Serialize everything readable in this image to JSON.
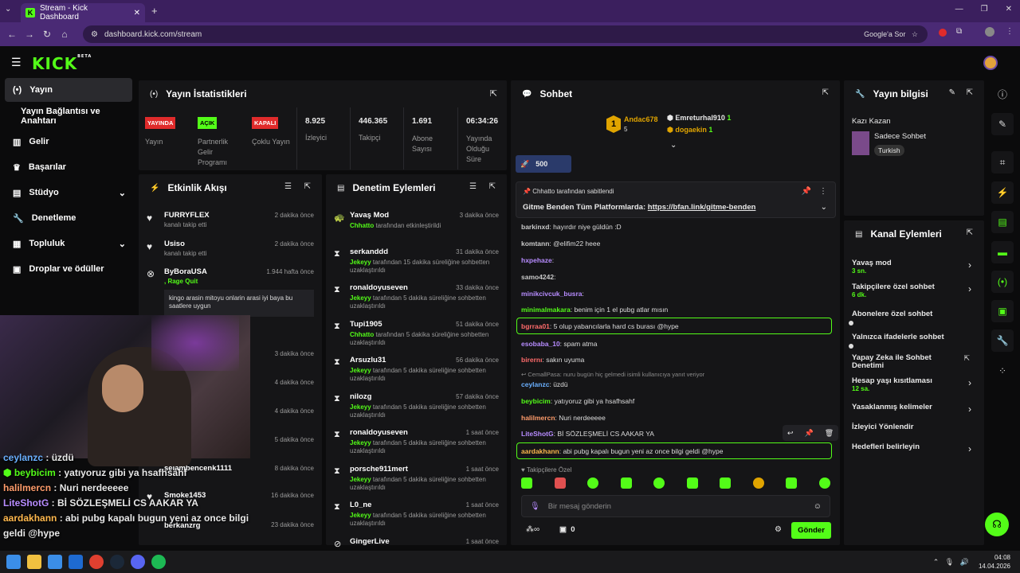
{
  "browser": {
    "tab_title": "Stream - Kick Dashboard",
    "url": "dashboard.kick.com/stream",
    "google_btn": "Google'a Sor"
  },
  "brand": {
    "logo": "KICK",
    "beta": "BETA",
    "accent": "#53fc18"
  },
  "sidebar": {
    "items": [
      "Yayın",
      "Yayın Bağlantısı ve Anahtarı",
      "Gelir",
      "Başarılar",
      "Stüdyo",
      "Denetleme",
      "Topluluk",
      "Droplar ve ödüller"
    ]
  },
  "stats": {
    "title": "Yayın İstatistikleri",
    "cells": [
      {
        "badge": "YAYINDA",
        "label": "Yayın"
      },
      {
        "badge": "AÇIK",
        "label": "Partnerlik Gelir Programı"
      },
      {
        "badge": "KAPALI",
        "label": "Çoklu Yayın"
      },
      {
        "value": "8.925",
        "label": "İzleyici"
      },
      {
        "value": "446.365",
        "label": "Takipçi"
      },
      {
        "value": "1.691",
        "label": "Abone Sayısı"
      },
      {
        "value": "06:34:26",
        "label": "Yayında Olduğu Süre"
      }
    ]
  },
  "activity": {
    "title": "Etkinlik Akışı",
    "items": [
      {
        "name": "FURRYFLEX",
        "sub": "kanalı takip etti",
        "time": "2 dakika önce"
      },
      {
        "name": "Usiso",
        "sub": "kanalı takip etti",
        "time": "2 dakika önce"
      },
      {
        "name": "ByBoraUSA",
        "sub": ", Rage Quit",
        "time": "1.944 hafta önce"
      },
      {
        "name": "selambencenk1111",
        "sub": "",
        "time": "8 dakika önce"
      },
      {
        "name": "Smoke1453",
        "sub": "",
        "time": "16 dakika önce"
      },
      {
        "name": "berkanzrg",
        "sub": "",
        "time": "23 dakika önce"
      }
    ],
    "quote": "kingo arasin mitoyu onlarin arasi iyi baya bu saatlere uygun",
    "times_hidden": [
      "3 dakika önce",
      "4 dakika önce",
      "4 dakika önce",
      "5 dakika önce"
    ]
  },
  "moderation": {
    "title": "Denetim Eylemleri",
    "items": [
      {
        "name": "Yavaş Mod",
        "sub": "Chhatto tarafından etkinleştirildi",
        "time": "3 dakika önce"
      },
      {
        "name": "serkanddd",
        "sub": "Jekeyy tarafından 15 dakika süreliğine sohbetten uzaklaştırıldı",
        "time": "31 dakika önce"
      },
      {
        "name": "ronaldoyuseven",
        "sub": "Jekeyy tarafından 5 dakika süreliğine sohbetten uzaklaştırıldı",
        "time": "33 dakika önce"
      },
      {
        "name": "Tupi1905",
        "sub": "Chhatto tarafından 5 dakika süreliğine sohbetten uzaklaştırıldı",
        "time": "51 dakika önce"
      },
      {
        "name": "Arsuzlu31",
        "sub": "Jekeyy tarafından 5 dakika süreliğine sohbetten uzaklaştırıldı",
        "time": "56 dakika önce"
      },
      {
        "name": "nilozg",
        "sub": "Jekeyy tarafından 5 dakika süreliğine sohbetten uzaklaştırıldı",
        "time": "57 dakika önce"
      },
      {
        "name": "ronaldoyuseven",
        "sub": "Jekeyy tarafından 5 dakika süreliğine sohbetten uzaklaştırıldı",
        "time": "1 saat önce"
      },
      {
        "name": "porsche911mert",
        "sub": "Jekeyy tarafından 5 dakika süreliğine sohbetten uzaklaştırıldı",
        "time": "1 saat önce"
      },
      {
        "name": "L0_ne",
        "sub": "Jekeyy tarafından 5 dakika süreliğine sohbetten uzaklaştırıldı",
        "time": "1 saat önce"
      },
      {
        "name": "GingerLive",
        "sub": "",
        "time": "1 saat önce"
      }
    ]
  },
  "chat": {
    "title": "Sohbet",
    "top": [
      {
        "name": "Andac678",
        "n": "5"
      },
      {
        "name": "Emreturhal910",
        "n": "1"
      },
      {
        "name": "dogaekin",
        "n": "1"
      }
    ],
    "gift": "500",
    "pinned_by": "Chhatto tarafından sabitlendi",
    "pinned_text": "Gitme Benden Tüm Platformlarda: ",
    "pinned_link": "https://bfan.link/gitme-benden",
    "messages": [
      {
        "u": "barkinxd",
        "t": "hayırdır niye güldün :D",
        "c": "#c9c9c9"
      },
      {
        "u": "komtann",
        "t": "@elifim22 heee",
        "c": "#c9c9c9"
      },
      {
        "u": "hxpehaze",
        "t": "",
        "c": "#b78cff"
      },
      {
        "u": "samo4242",
        "t": "",
        "c": "#c9c9c9"
      },
      {
        "u": "minikcivcuk_busra",
        "t": "",
        "c": "#b78cff"
      },
      {
        "u": "minimalmakara",
        "t": "benim için 1 el pubg atlar mısın",
        "c": "#53fc18"
      },
      {
        "u": "bgrraa01",
        "t": "5 olup yabancılarla hard cs burası @hype",
        "c": "#ff6b6b"
      },
      {
        "u": "esobaba_10",
        "t": "spam atma",
        "c": "#b78cff"
      },
      {
        "u": "birernı",
        "t": "sakın uyuma",
        "c": "#ff6b6b"
      },
      {
        "u": "ceylanzc",
        "t": "üzdü",
        "c": "#6ab0ff"
      },
      {
        "u": "beybicim",
        "t": "yatıyoruz gibi ya hsafhsahf",
        "c": "#53fc18"
      },
      {
        "u": "halilmercn",
        "t": "Nuri nerdeeeee",
        "c": "#ff9c6b"
      },
      {
        "u": "LiteShotG",
        "t": "Bİ SÖZLEŞMELİ CS AAKAR YA",
        "c": "#b78cff"
      },
      {
        "u": "aardakhann",
        "t": "abi pubg kapalı bugun yeni az once bilgi geldi @hype",
        "c": "#ffb84d"
      }
    ],
    "reply_note": "CemallPasa: nuru bugün hiç gelmedi isimli kullanıcıya yanıt veriyor",
    "followers_only": "Takipçilere Özel",
    "placeholder": "Bir mesaj gönderin",
    "points": "0",
    "send": "Gönder"
  },
  "overlay_chat": [
    {
      "u": "ceylanzc",
      "t": " : üzdü"
    },
    {
      "u": "beybicim",
      "t": " : yatıyoruz gibi ya hsafhsahf"
    },
    {
      "u": "halilmercn",
      "t": " : Nuri nerdeeeee"
    },
    {
      "u": "LiteShotG",
      "t": " : Bİ SÖZLEŞMELİ CS AAKAR YA"
    },
    {
      "u": "aardakhann",
      "t": " : abi pubg kapalı bugun yeni az once bilgi"
    },
    {
      "u": "",
      "t": "geldi @hype"
    }
  ],
  "info": {
    "title": "Yayın bilgisi",
    "stream_title": "Kazı Kazan",
    "category": "Sadece Sohbet",
    "lang": "Turkish"
  },
  "channel": {
    "title": "Kanal Eylemleri",
    "items": [
      {
        "label": "Yavaş mod",
        "sub": "3 sn."
      },
      {
        "label": "Takipçilere özel sohbet",
        "sub": "6 dk."
      },
      {
        "label": "Abonelere özel sohbet",
        "sub": ""
      },
      {
        "label": "Yalnızca ifadelerle sohbet",
        "sub": ""
      },
      {
        "label": "Yapay Zeka ile Sohbet Denetimi",
        "sub": ""
      },
      {
        "label": "Hesap yaşı kısıtlaması",
        "sub": "12 sa."
      },
      {
        "label": "Yasaklanmış kelimeler",
        "sub": ""
      },
      {
        "label": "İzleyici Yönlendir",
        "sub": ""
      },
      {
        "label": "Hedefleri belirleyin",
        "sub": ""
      }
    ]
  },
  "clock": {
    "time": "04:08",
    "date": "14.04.2026"
  }
}
